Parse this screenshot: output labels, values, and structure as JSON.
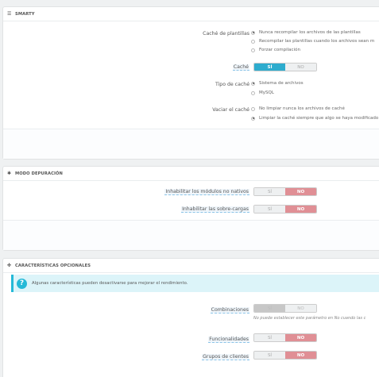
{
  "smarty": {
    "title": "SMARTY",
    "icon": "list-icon",
    "cache_label": "Caché de plantillas",
    "cache_options": [
      "Nunca recompilar los archivos de las plantillas",
      "Recompilar las plantillas cuando los archivos sean m",
      "Forzar compilación"
    ],
    "cache_selected": 0,
    "cache_switch_label": "Caché",
    "cache_switch_yes": "SÍ",
    "cache_switch_no": "NO",
    "cache_type_label": "Tipo de caché",
    "cache_type_options": [
      "Sistema de archivos",
      "MySQL"
    ],
    "cache_type_selected": 0,
    "clear_cache_label": "Vaciar el caché",
    "clear_cache_options": [
      "No limpiar nunca los archivos de caché",
      "Limpiar la caché siempre que algo se haya modificado"
    ],
    "clear_cache_selected": 1
  },
  "debug": {
    "title": "MODO DEPURACIÓN",
    "icon": "bug-icon",
    "rows": [
      {
        "label": "Inhabilitar los módulos no nativos",
        "yes": "SÍ",
        "no": "NO"
      },
      {
        "label": "Inhabilitar las sobre-cargas",
        "yes": "SÍ",
        "no": "NO"
      }
    ]
  },
  "optional": {
    "title": "CARACTERÍSTICAS OPCIONALES",
    "icon": "puzzle-icon",
    "alert_text": "Algunas características pueden desactivarse para mejorar el rendimiento.",
    "combinations_label": "Combinaciones",
    "combinations_yes": "SÍ",
    "combinations_no": "NO",
    "combinations_help": "No puede establecer este parámetro en No cuando las c",
    "features_label": "Funcionalidades",
    "features_yes": "SÍ",
    "features_no": "NO",
    "groups_label": "Grupos de clientes",
    "groups_yes": "SÍ",
    "groups_no": "NO"
  },
  "colors": {
    "accent_blue": "#2eacce",
    "no_red": "#e08f95",
    "info_bg": "#dcf4f9"
  }
}
